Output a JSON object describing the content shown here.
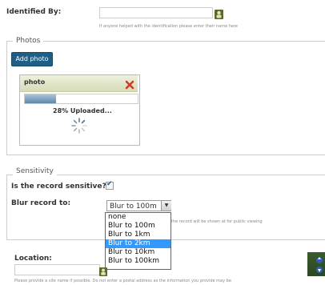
{
  "identified_by": {
    "label": "Identified By:",
    "hint": "If anyone helped with the identification please enter their name here"
  },
  "photos": {
    "legend": "Photos",
    "add_button": "Add photo",
    "panel": {
      "title": "photo",
      "progress_percent": 28,
      "status": "28% Uploaded..."
    }
  },
  "sensitivity": {
    "legend": "Sensitivity",
    "question": "Is the record sensitive?:",
    "checked": true,
    "blur_label": "Blur record to:",
    "selected": "Blur to 100m",
    "options": [
      "none",
      "Blur to 100m",
      "Blur to 1km",
      "Blur to 2km",
      "Blur to 10km",
      "Blur to 100km"
    ],
    "highlighted_index": 3,
    "hint": "the record will be shown at for public viewing"
  },
  "location": {
    "label": "Location:",
    "hint": "Please provide a site name if possible. Do not enter a postal address as the information you provide may be"
  },
  "colors": {
    "button_bg": "#1f5f86",
    "dropdown_highlight": "#3399ff"
  }
}
